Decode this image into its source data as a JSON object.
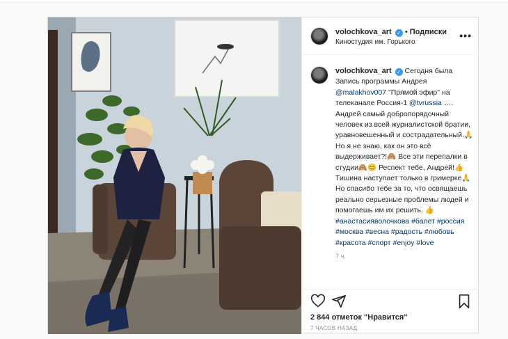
{
  "colors": {
    "link": "#00376b",
    "verified": "#3897f0",
    "muted": "#8e8e8e"
  },
  "post": {
    "username": "volochkova_art",
    "separator": "•",
    "follow_label": "Подписки",
    "location": "Киностудия им. Горького",
    "more_icon": "more-dots-icon",
    "caption": {
      "username": "volochkova_art",
      "p1": "Сегодня была Запись программы Андрея",
      "mention1": "@malakhov007",
      "p2": "\"Прямой эфир\" на телеканале Россия-1",
      "mention2": "@tvrussia",
      "p3": "…. Андрей самый добропорядочный человек из всей журналистской братии, уравновешенный и сострадательный.🙏 Но я не знаю, как он это всё выдерживает?!🙈 Все эти перепалки в студии🙈😊 Респект тебе, Андрей!👍 Тишина наступает только в гримерке🙏 Но спасибо тебе за то, что освящаешь реально серьезные проблемы людей и помогаешь им их решить. 👍",
      "hashtags": [
        "#анастасияволочкова",
        "#балет",
        "#россия",
        "#москва",
        "#весна",
        "#радость",
        "#любовь",
        "#красота",
        "#спорт",
        "#enjoy",
        "#love"
      ]
    },
    "caption_age": "7 ч.",
    "likes": "2 844 отметок \"Нравится\"",
    "timestamp": "7 часов назад",
    "icons": {
      "like": "heart-icon",
      "share": "share-icon",
      "save": "bookmark-icon"
    }
  }
}
